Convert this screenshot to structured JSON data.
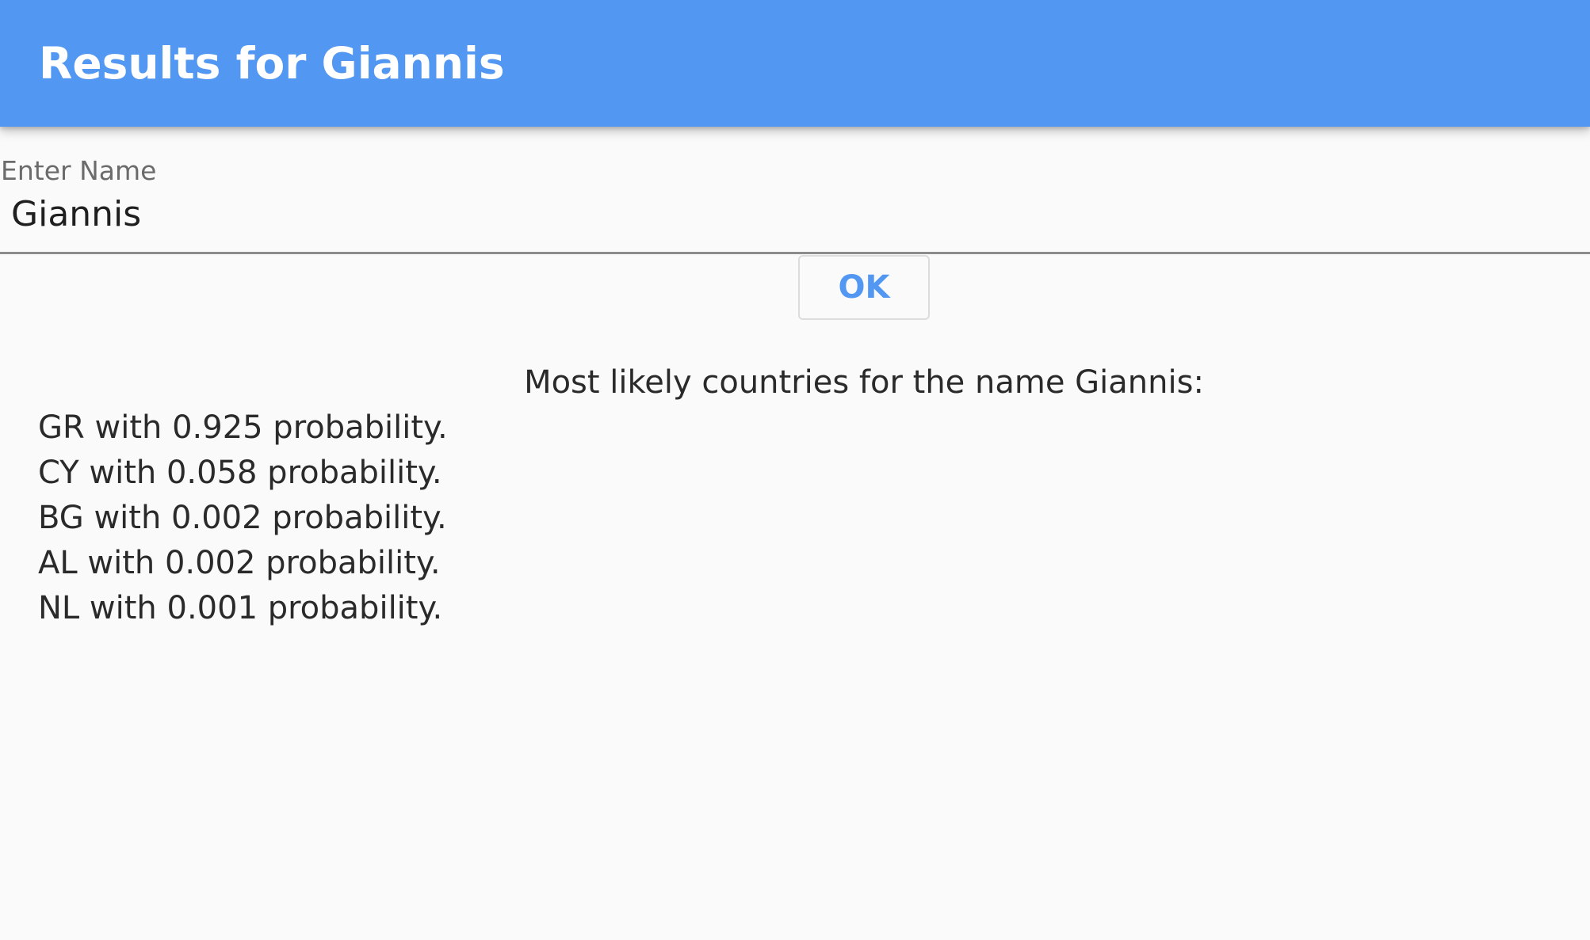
{
  "app_bar": {
    "title": "Results for Giannis"
  },
  "name_field": {
    "label": "Enter Name",
    "value": "Giannis"
  },
  "ok_button": {
    "label": "OK"
  },
  "results": {
    "heading": "Most likely countries for the name Giannis:",
    "items": [
      "GR with 0.925 probability.",
      "CY with 0.058 probability.",
      "BG with 0.002 probability.",
      "AL with 0.002 probability.",
      "NL with 0.001 probability."
    ]
  },
  "colors": {
    "app_bar": "#5297f1",
    "background": "#fafafa",
    "accent": "#5297f1"
  }
}
